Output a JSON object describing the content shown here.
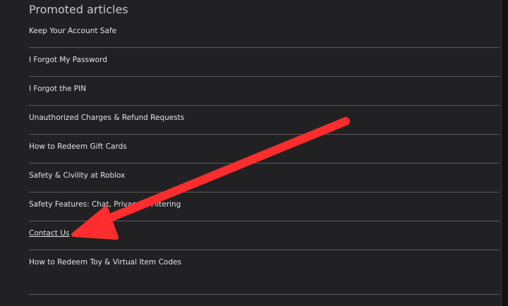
{
  "section": {
    "heading": "Promoted articles",
    "articles": [
      "Keep Your Account Safe",
      "I Forgot My Password",
      "I Forgot the PIN",
      "Unauthorized Charges & Refund Requests",
      "How to Redeem Gift Cards",
      "Safety & Civility at Roblox",
      "Safety Features: Chat, Privacy & Filtering",
      "Contact Us",
      "How to Redeem Toy & Virtual Item Codes"
    ]
  },
  "annotation": {
    "arrow_color": "#ff2d2d"
  },
  "colors": {
    "background": "#212124",
    "text": "#e3e3e5",
    "divider": "#5d5d61"
  }
}
